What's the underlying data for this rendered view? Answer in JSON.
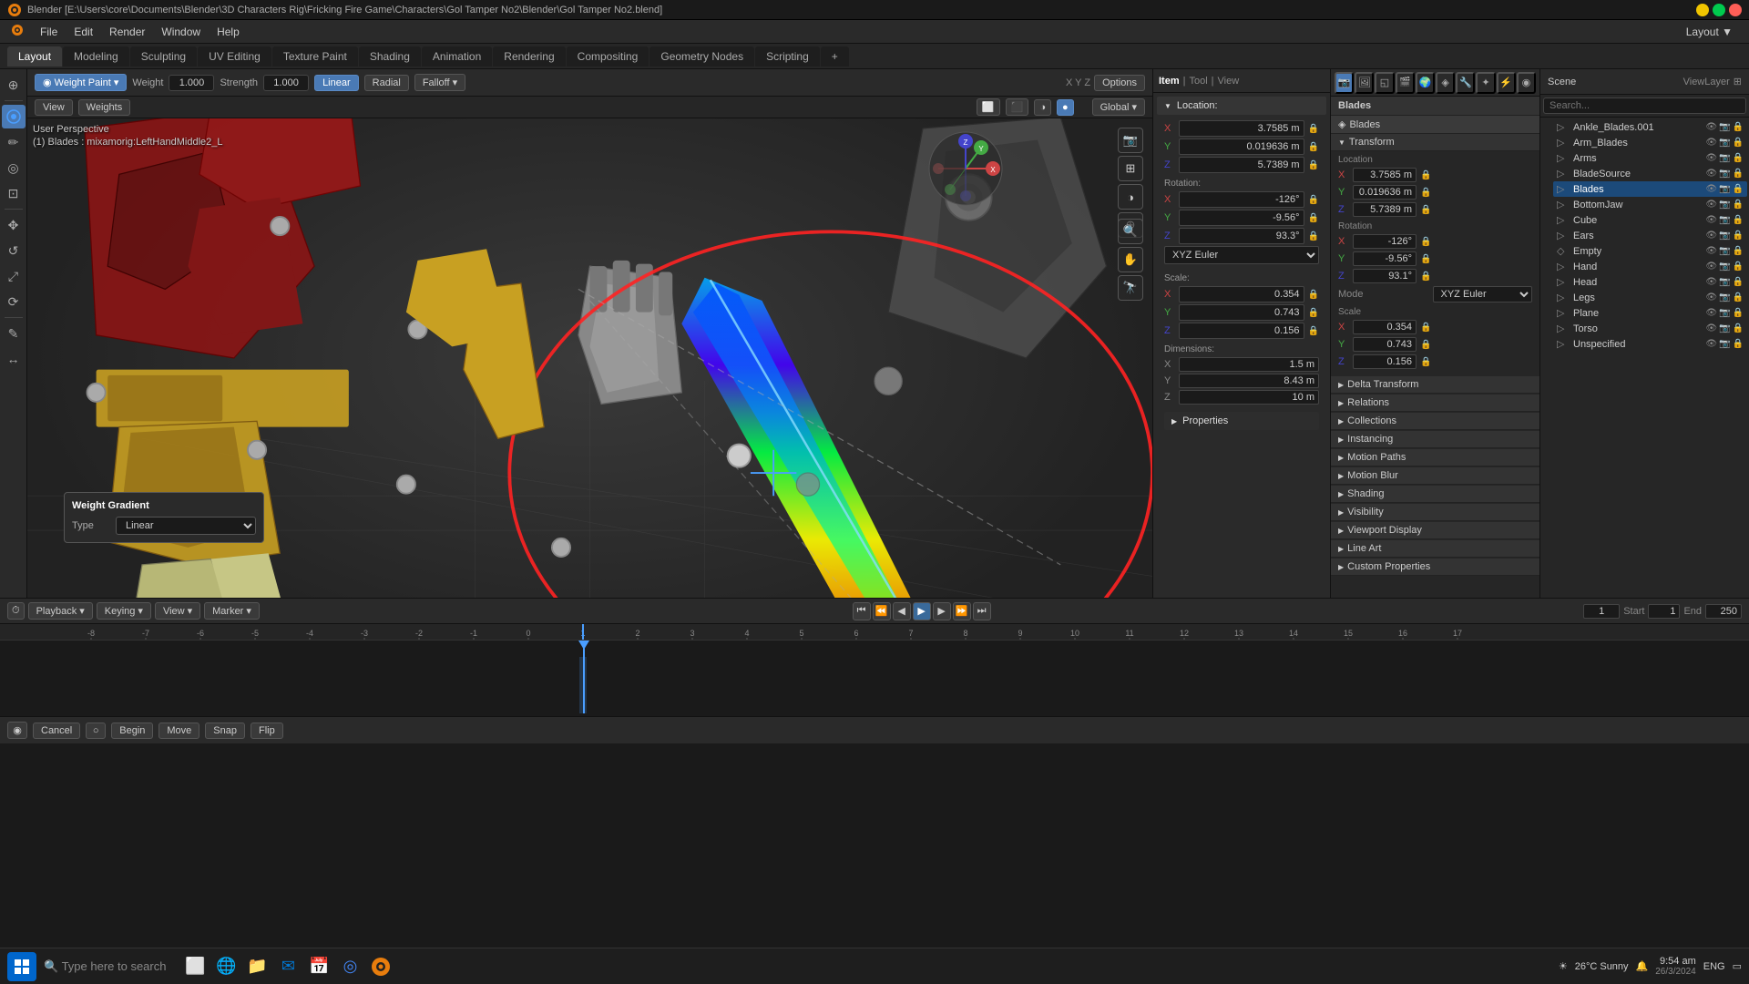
{
  "titlebar": {
    "title": "Blender [E:\\Users\\core\\Documents\\Blender\\3D Characters Rig\\Fricking Fire Game\\Characters\\Gol Tamper No2\\Blender\\Gol Tamper No2.blend]",
    "close_label": "×",
    "min_label": "−",
    "max_label": "□"
  },
  "menubar": {
    "items": [
      "Blender",
      "File",
      "Edit",
      "Render",
      "Window",
      "Help"
    ]
  },
  "workspace": {
    "tabs": [
      "Layout",
      "Modeling",
      "Sculpting",
      "UV Editing",
      "Texture Paint",
      "Shading",
      "Animation",
      "Rendering",
      "Compositing",
      "Geometry Nodes",
      "Scripting",
      "+"
    ],
    "active": "Layout"
  },
  "viewport": {
    "mode": "Weight Paint",
    "weight_label": "Weight",
    "weight_value": "1.000",
    "strength_label": "Strength",
    "strength_value": "1.000",
    "linear_label": "Linear",
    "radial_label": "Radial",
    "falloff_label": "Falloff",
    "view_label": "View",
    "weights_label": "Weights",
    "perspective": "User Perspective",
    "object_info": "(1) Blades : mixamorig:LeftHandMiddle2_L",
    "global_label": "Global",
    "options_label": "Options",
    "x_label": "X",
    "y_label": "Y",
    "z_label": "Z"
  },
  "weight_gradient": {
    "title": "Weight Gradient",
    "type_label": "Type",
    "type_value": "Linear"
  },
  "transform": {
    "location_label": "Location:",
    "lx": "3.7585 m",
    "ly": "0.019636 m",
    "lz": "5.7389 m",
    "rotation_label": "Rotation:",
    "rx": "-126°",
    "ry": "-9.56°",
    "rz": "93.3°",
    "rotation_mode": "XYZ Euler",
    "scale_label": "Scale:",
    "sx": "0.354",
    "sy": "0.743",
    "sz": "0.156",
    "dimensions_label": "Dimensions:",
    "dx": "1.5 m",
    "dy": "8.43 m",
    "dz": "10 m"
  },
  "properties_panel": {
    "section_label": "Blades",
    "transform_label": "Transform",
    "location_x": "3.7585 m",
    "location_y": "0.019636 m",
    "location_z": "5.7389 m",
    "rotation_x": "-126°",
    "rotation_y": "-9.56°",
    "rotation_z": "93.1°",
    "mode_label": "Mode",
    "mode_value": "XYZ Euler",
    "scale_x": "0.354",
    "scale_y": "0.743",
    "scale_z": "0.156",
    "delta_transform_label": "Delta Transform",
    "relations_label": "Relations",
    "collections_label": "Collections",
    "instancing_label": "Instancing",
    "motion_paths_label": "Motion Paths",
    "motion_blur_label": "Motion Blur",
    "shading_label": "Shading",
    "visibility_label": "Visibility",
    "viewport_display_label": "Viewport Display",
    "line_art_label": "Line Art",
    "custom_properties_label": "Custom Properties"
  },
  "outliner": {
    "title_label": "Scene",
    "view_layer_label": "ViewLayer",
    "items": [
      {
        "name": "Ankle_Blades.001",
        "indent": 2,
        "icon": "▷",
        "selected": false
      },
      {
        "name": "Arm_Blades",
        "indent": 2,
        "icon": "▷",
        "selected": false
      },
      {
        "name": "Arms",
        "indent": 2,
        "icon": "▷",
        "selected": false
      },
      {
        "name": "BladeSource",
        "indent": 2,
        "icon": "▷",
        "selected": false
      },
      {
        "name": "Blades",
        "indent": 2,
        "icon": "▷",
        "selected": true,
        "highlighted": true
      },
      {
        "name": "BottomJaw",
        "indent": 2,
        "icon": "▷",
        "selected": false
      },
      {
        "name": "Cube",
        "indent": 2,
        "icon": "▷",
        "selected": false
      },
      {
        "name": "Ears",
        "indent": 2,
        "icon": "▷",
        "selected": false
      },
      {
        "name": "Empty",
        "indent": 2,
        "icon": "◇",
        "selected": false
      },
      {
        "name": "Hand",
        "indent": 2,
        "icon": "▷",
        "selected": false
      },
      {
        "name": "Head",
        "indent": 2,
        "icon": "▷",
        "selected": false
      },
      {
        "name": "Legs",
        "indent": 2,
        "icon": "▷",
        "selected": false
      },
      {
        "name": "Plane",
        "indent": 2,
        "icon": "▷",
        "selected": false
      },
      {
        "name": "Torso",
        "indent": 2,
        "icon": "▷",
        "selected": false
      },
      {
        "name": "Unspecified",
        "indent": 2,
        "icon": "▷",
        "selected": false
      }
    ]
  },
  "timeline": {
    "playback_label": "Playback",
    "keying_label": "Keying",
    "view_label": "View",
    "marker_label": "Marker",
    "start_label": "Start",
    "start_value": "1",
    "end_label": "End",
    "end_value": "250",
    "current_frame": "1",
    "frame_numbers": [
      "-8",
      "-7",
      "-6",
      "-5",
      "-4",
      "-3",
      "-2",
      "-1",
      "0",
      "1",
      "2",
      "3",
      "4",
      "5",
      "6",
      "7",
      "8",
      "9",
      "10",
      "11",
      "12",
      "13",
      "14",
      "15",
      "16",
      "17"
    ]
  },
  "bottom_bar": {
    "cancel_label": "Cancel",
    "begin_label": "Begin",
    "move_label": "Move",
    "snap_label": "Snap",
    "flip_label": "Flip"
  },
  "taskbar": {
    "time": "9:54 am",
    "date": "26/3/2024",
    "weather": "26°C Sunny",
    "language": "ENG"
  },
  "icons": {
    "arrow_down": "▼",
    "arrow_right": "▶",
    "cursor": "⊕",
    "move": "✥",
    "rotate": "↺",
    "scale": "⤢",
    "transform": "⟳",
    "annotate": "✏",
    "measure": "📏",
    "add": "+",
    "select": "▢",
    "lock": "🔒",
    "eye": "👁",
    "filter": "⊞",
    "camera": "📷",
    "light": "☀",
    "mesh": "◈",
    "chain": "⛓"
  }
}
